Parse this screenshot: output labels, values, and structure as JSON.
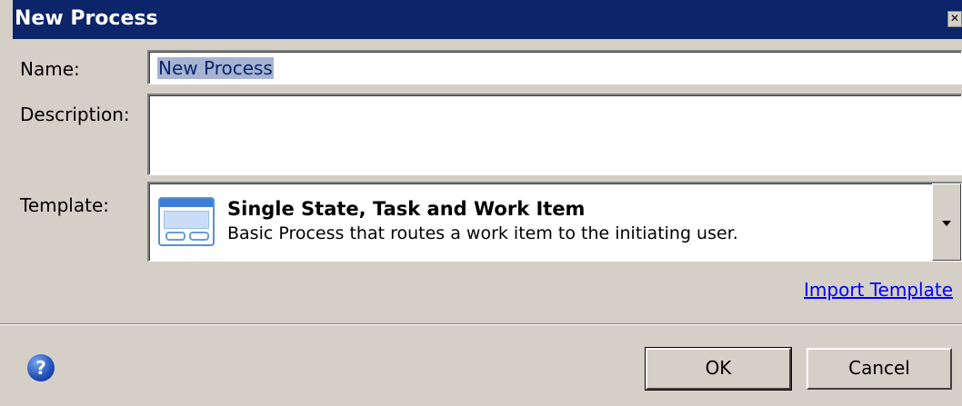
{
  "window": {
    "title": "New Process",
    "close_label": "✕"
  },
  "form": {
    "name_label": "Name:",
    "name_value": "New Process",
    "description_label": "Description:",
    "description_value": "",
    "template_label": "Template:",
    "template": {
      "icon": "window-template-icon",
      "title": "Single State, Task and Work Item",
      "description": "Basic Process that routes a work item to the initiating user."
    },
    "import_link": "Import Template"
  },
  "footer": {
    "help_icon": "?",
    "ok_label": "OK",
    "cancel_label": "Cancel"
  },
  "colors": {
    "titlebar": "#0b246a",
    "link": "#0000ff",
    "selection": "#a6b4d2"
  }
}
